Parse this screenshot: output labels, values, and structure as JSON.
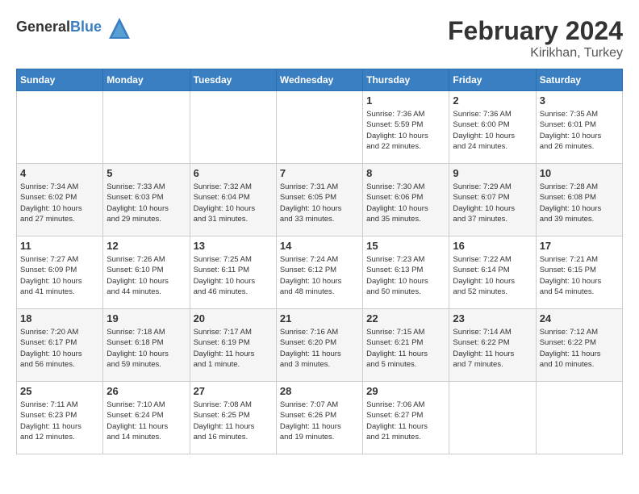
{
  "header": {
    "logo_general": "General",
    "logo_blue": "Blue",
    "month_year": "February 2024",
    "location": "Kirikhan, Turkey"
  },
  "days_of_week": [
    "Sunday",
    "Monday",
    "Tuesday",
    "Wednesday",
    "Thursday",
    "Friday",
    "Saturday"
  ],
  "weeks": [
    [
      {
        "day": "",
        "info": ""
      },
      {
        "day": "",
        "info": ""
      },
      {
        "day": "",
        "info": ""
      },
      {
        "day": "",
        "info": ""
      },
      {
        "day": "1",
        "info": "Sunrise: 7:36 AM\nSunset: 5:59 PM\nDaylight: 10 hours\nand 22 minutes."
      },
      {
        "day": "2",
        "info": "Sunrise: 7:36 AM\nSunset: 6:00 PM\nDaylight: 10 hours\nand 24 minutes."
      },
      {
        "day": "3",
        "info": "Sunrise: 7:35 AM\nSunset: 6:01 PM\nDaylight: 10 hours\nand 26 minutes."
      }
    ],
    [
      {
        "day": "4",
        "info": "Sunrise: 7:34 AM\nSunset: 6:02 PM\nDaylight: 10 hours\nand 27 minutes."
      },
      {
        "day": "5",
        "info": "Sunrise: 7:33 AM\nSunset: 6:03 PM\nDaylight: 10 hours\nand 29 minutes."
      },
      {
        "day": "6",
        "info": "Sunrise: 7:32 AM\nSunset: 6:04 PM\nDaylight: 10 hours\nand 31 minutes."
      },
      {
        "day": "7",
        "info": "Sunrise: 7:31 AM\nSunset: 6:05 PM\nDaylight: 10 hours\nand 33 minutes."
      },
      {
        "day": "8",
        "info": "Sunrise: 7:30 AM\nSunset: 6:06 PM\nDaylight: 10 hours\nand 35 minutes."
      },
      {
        "day": "9",
        "info": "Sunrise: 7:29 AM\nSunset: 6:07 PM\nDaylight: 10 hours\nand 37 minutes."
      },
      {
        "day": "10",
        "info": "Sunrise: 7:28 AM\nSunset: 6:08 PM\nDaylight: 10 hours\nand 39 minutes."
      }
    ],
    [
      {
        "day": "11",
        "info": "Sunrise: 7:27 AM\nSunset: 6:09 PM\nDaylight: 10 hours\nand 41 minutes."
      },
      {
        "day": "12",
        "info": "Sunrise: 7:26 AM\nSunset: 6:10 PM\nDaylight: 10 hours\nand 44 minutes."
      },
      {
        "day": "13",
        "info": "Sunrise: 7:25 AM\nSunset: 6:11 PM\nDaylight: 10 hours\nand 46 minutes."
      },
      {
        "day": "14",
        "info": "Sunrise: 7:24 AM\nSunset: 6:12 PM\nDaylight: 10 hours\nand 48 minutes."
      },
      {
        "day": "15",
        "info": "Sunrise: 7:23 AM\nSunset: 6:13 PM\nDaylight: 10 hours\nand 50 minutes."
      },
      {
        "day": "16",
        "info": "Sunrise: 7:22 AM\nSunset: 6:14 PM\nDaylight: 10 hours\nand 52 minutes."
      },
      {
        "day": "17",
        "info": "Sunrise: 7:21 AM\nSunset: 6:15 PM\nDaylight: 10 hours\nand 54 minutes."
      }
    ],
    [
      {
        "day": "18",
        "info": "Sunrise: 7:20 AM\nSunset: 6:17 PM\nDaylight: 10 hours\nand 56 minutes."
      },
      {
        "day": "19",
        "info": "Sunrise: 7:18 AM\nSunset: 6:18 PM\nDaylight: 10 hours\nand 59 minutes."
      },
      {
        "day": "20",
        "info": "Sunrise: 7:17 AM\nSunset: 6:19 PM\nDaylight: 11 hours\nand 1 minute."
      },
      {
        "day": "21",
        "info": "Sunrise: 7:16 AM\nSunset: 6:20 PM\nDaylight: 11 hours\nand 3 minutes."
      },
      {
        "day": "22",
        "info": "Sunrise: 7:15 AM\nSunset: 6:21 PM\nDaylight: 11 hours\nand 5 minutes."
      },
      {
        "day": "23",
        "info": "Sunrise: 7:14 AM\nSunset: 6:22 PM\nDaylight: 11 hours\nand 7 minutes."
      },
      {
        "day": "24",
        "info": "Sunrise: 7:12 AM\nSunset: 6:22 PM\nDaylight: 11 hours\nand 10 minutes."
      }
    ],
    [
      {
        "day": "25",
        "info": "Sunrise: 7:11 AM\nSunset: 6:23 PM\nDaylight: 11 hours\nand 12 minutes."
      },
      {
        "day": "26",
        "info": "Sunrise: 7:10 AM\nSunset: 6:24 PM\nDaylight: 11 hours\nand 14 minutes."
      },
      {
        "day": "27",
        "info": "Sunrise: 7:08 AM\nSunset: 6:25 PM\nDaylight: 11 hours\nand 16 minutes."
      },
      {
        "day": "28",
        "info": "Sunrise: 7:07 AM\nSunset: 6:26 PM\nDaylight: 11 hours\nand 19 minutes."
      },
      {
        "day": "29",
        "info": "Sunrise: 7:06 AM\nSunset: 6:27 PM\nDaylight: 11 hours\nand 21 minutes."
      },
      {
        "day": "",
        "info": ""
      },
      {
        "day": "",
        "info": ""
      }
    ]
  ]
}
